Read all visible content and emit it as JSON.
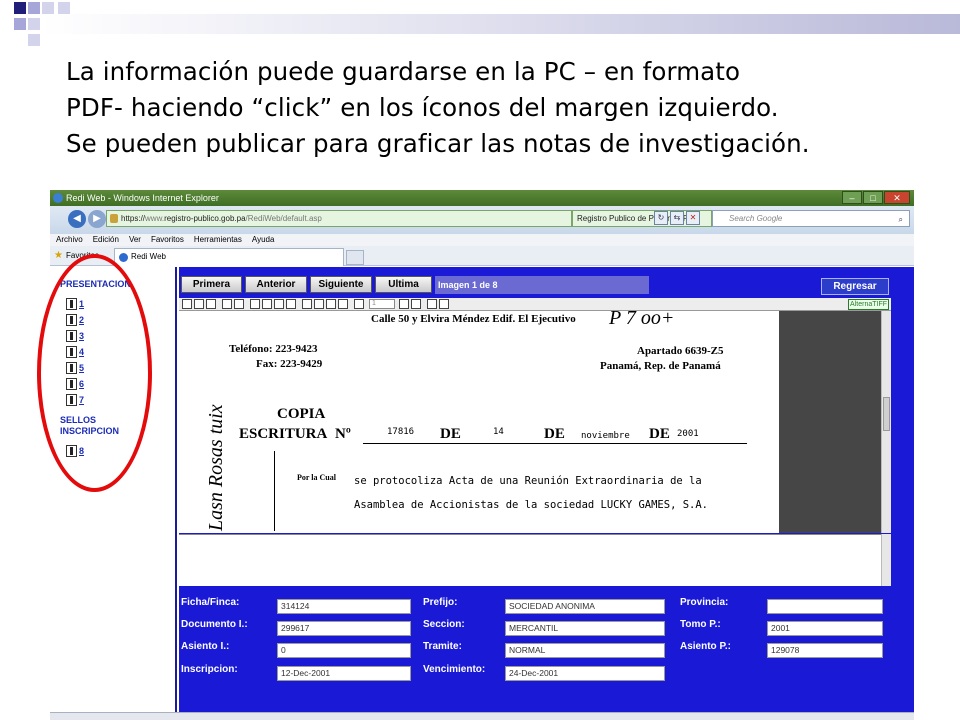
{
  "slide": {
    "lines": [
      "La información puede guardarse en la PC – en formato",
      "PDF- haciendo “click” en los íconos del margen izquierdo.",
      "Se pueden publicar para graficar las notas de investigación."
    ]
  },
  "browser": {
    "window_title": "Redi Web - Windows Internet Explorer",
    "address_scheme": "https://",
    "address_www": "www.",
    "address_host": "registro-publico.gob.pa",
    "address_path": "/RediWeb/default.asp",
    "cert_label": "Registro Publico de Panama [PA]",
    "search_placeholder": "Search Google",
    "menu": [
      "Archivo",
      "Edición",
      "Ver",
      "Favoritos",
      "Herramientas",
      "Ayuda"
    ],
    "favorites_label": "Favoritos",
    "tab_title": "Redi Web"
  },
  "left_pane": {
    "presentacion_title": "PRESENTACION",
    "presentacion_items": [
      "1",
      "2",
      "3",
      "4",
      "5",
      "6",
      "7"
    ],
    "sellos_title_1": "SELLOS",
    "sellos_title_2": "INSCRIPCION",
    "sellos_items": [
      "8"
    ]
  },
  "viewer": {
    "buttons": [
      "Primera",
      "Anterior",
      "Siguiente",
      "Ultima"
    ],
    "image_label": "Imagen 1 de 8",
    "regresar": "Regresar",
    "alternatiff": "AlternaTIFF",
    "page_box": "1"
  },
  "document": {
    "address_line": "Calle 50 y Elvira Méndez Edif. El Ejecutivo",
    "telefono": "Teléfono: 223-9423",
    "fax": "Fax: 223-9429",
    "apartado": "Apartado 6639-Z5",
    "ciudad": "Panamá, Rep. de Panamá",
    "copia": "COPIA",
    "escritura": "ESCRITURA",
    "numero_label": "Nº",
    "numero": "17816",
    "de1": "DE",
    "dia": "14",
    "de2": "DE",
    "mes": "noviembre",
    "de3": "DE",
    "anio": "2001",
    "por_la_cual": "Por la Cual",
    "line1": "se protocoliza Acta de una Reunión Extraordinaria de la",
    "line2": "Asamblea de Accionistas de la sociedad LUCKY GAMES, S.A.",
    "scribble_top": "P  7 oo+",
    "vertical_text": "Lasn Rosas tuix"
  },
  "form": {
    "ficha_label": "Ficha/Finca:",
    "ficha_value": "314124",
    "documento_label": "Documento I.:",
    "documento_value": "299617",
    "asiento_label": "Asiento I.:",
    "asiento_value": "0",
    "inscripcion_label": "Inscripcion:",
    "inscripcion_value": "12-Dec-2001",
    "prefijo_label": "Prefijo:",
    "prefijo_value": "SOCIEDAD ANONIMA",
    "seccion_label": "Seccion:",
    "seccion_value": "MERCANTIL",
    "tramite_label": "Tramite:",
    "tramite_value": "NORMAL",
    "vencimiento_label": "Vencimiento:",
    "vencimiento_value": "24-Dec-2001",
    "provincia_label": "Provincia:",
    "provincia_value": "",
    "tomo_label": "Tomo P.:",
    "tomo_value": "2001",
    "asientop_label": "Asiento P.:",
    "asientop_value": "129078"
  },
  "colors": {
    "highlight_oval": "#e30b0b",
    "page_blue": "#1a1ad6",
    "link_blue": "#1b2cb6"
  }
}
